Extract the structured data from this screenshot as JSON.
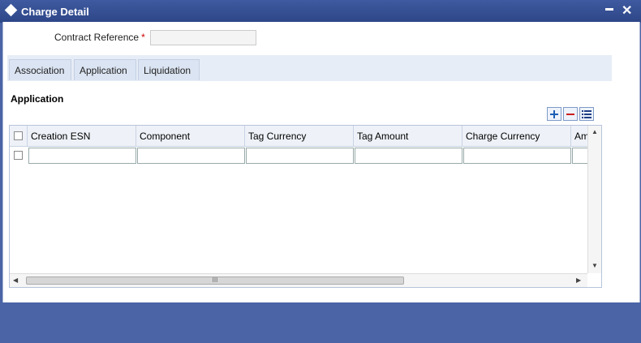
{
  "window": {
    "title": "Charge Detail",
    "minimize_glyph": "▬",
    "close_glyph": "✕"
  },
  "form": {
    "contract_reference_label": "Contract Reference",
    "required_marker": "*",
    "contract_reference_value": ""
  },
  "tabs": [
    {
      "label": "Association"
    },
    {
      "label": "Application"
    },
    {
      "label": "Liquidation"
    }
  ],
  "section": {
    "title": "Application"
  },
  "toolbar": {
    "add_icon": "plus-icon",
    "remove_icon": "minus-icon",
    "view_icon": "list-icon"
  },
  "grid": {
    "columns": [
      "Creation ESN",
      "Component",
      "Tag Currency",
      "Tag Amount",
      "Charge Currency",
      "Am"
    ],
    "rows": [
      [
        "",
        "",
        "",
        "",
        "",
        ""
      ]
    ]
  },
  "scrollbar": {
    "thumb_glyph": "III"
  },
  "colors": {
    "title_bar": "#2d4687",
    "frame": "#4a64a6",
    "tab_strip": "#e7edf6"
  }
}
